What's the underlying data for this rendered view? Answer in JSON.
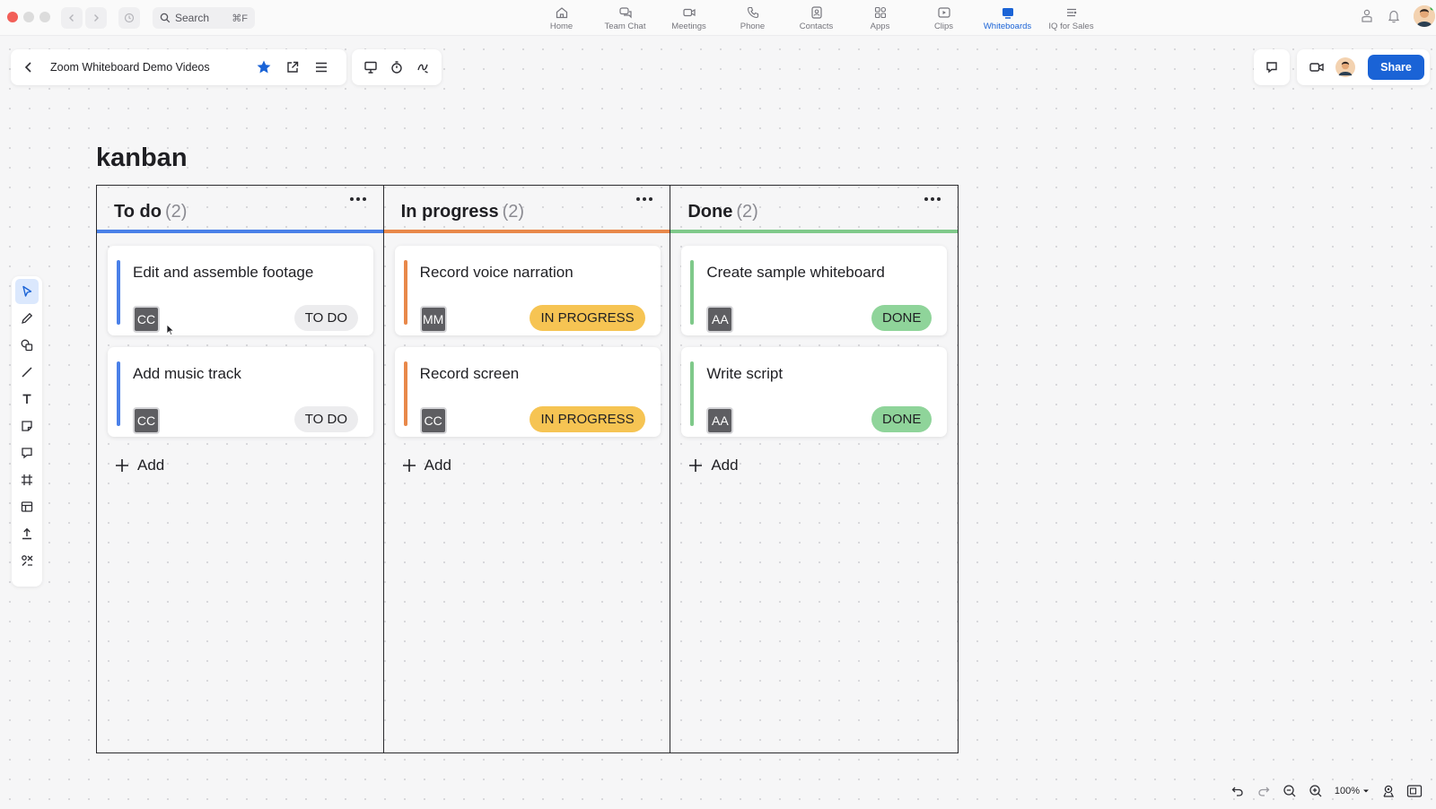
{
  "app": {
    "search_label": "Search",
    "search_shortcut": "⌘F",
    "nav": [
      {
        "label": "Home",
        "icon": "home-icon"
      },
      {
        "label": "Team Chat",
        "icon": "chat-icon"
      },
      {
        "label": "Meetings",
        "icon": "video-icon"
      },
      {
        "label": "Phone",
        "icon": "phone-icon"
      },
      {
        "label": "Contacts",
        "icon": "contacts-icon"
      },
      {
        "label": "Apps",
        "icon": "apps-icon"
      },
      {
        "label": "Clips",
        "icon": "clips-icon"
      },
      {
        "label": "Whiteboards",
        "icon": "whiteboard-icon",
        "active": true
      },
      {
        "label": "IQ for Sales",
        "icon": "iq-icon"
      }
    ],
    "accent": "#1a63d6"
  },
  "doc": {
    "title": "Zoom Whiteboard Demo Videos",
    "share_label": "Share",
    "starred": true
  },
  "board": {
    "title": "kanban",
    "add_label": "Add",
    "columns": [
      {
        "title": "To do",
        "count": "(2)",
        "color": "#4a80e8",
        "cards": [
          {
            "title": "Edit and assemble footage",
            "assignee": "CC",
            "status": "TO DO"
          },
          {
            "title": "Add music track",
            "assignee": "CC",
            "status": "TO DO"
          }
        ]
      },
      {
        "title": "In progress",
        "count": "(2)",
        "color": "#e8884a",
        "cards": [
          {
            "title": "Record voice narration",
            "assignee": "MM",
            "status": "IN PROGRESS"
          },
          {
            "title": "Record screen",
            "assignee": "CC",
            "status": "IN PROGRESS"
          }
        ]
      },
      {
        "title": "Done",
        "count": "(2)",
        "color": "#7fc98a",
        "cards": [
          {
            "title": "Create sample whiteboard",
            "assignee": "AA",
            "status": "DONE"
          },
          {
            "title": "Write script",
            "assignee": "AA",
            "status": "DONE"
          }
        ]
      }
    ],
    "status_colors": {
      "TO DO": "#ececee",
      "IN PROGRESS": "#f6c453",
      "DONE": "#8fd49a"
    }
  },
  "zoom": {
    "level": "100%"
  }
}
